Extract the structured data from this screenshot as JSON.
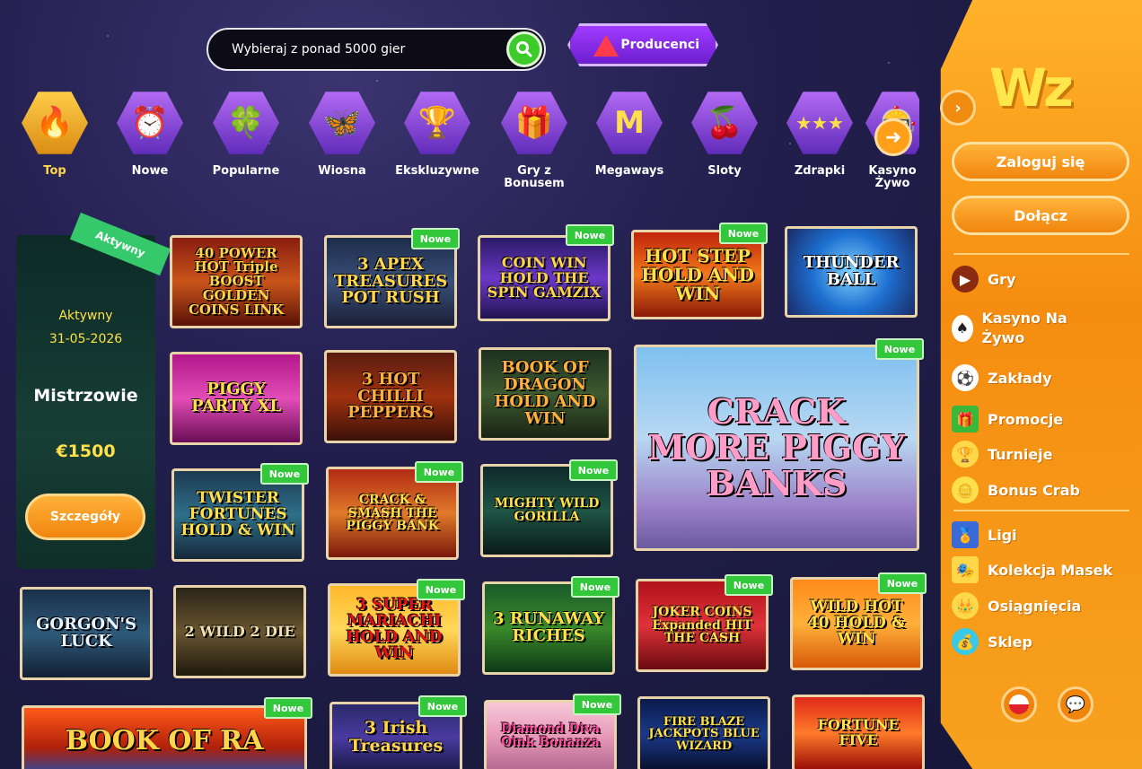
{
  "search": {
    "placeholder": "Wybieraj z ponad 5000 gier"
  },
  "producers_label": "Producenci",
  "categories": [
    {
      "label": "Top",
      "icon": "fire-icon"
    },
    {
      "label": "Nowe",
      "icon": "alarm-clock-icon"
    },
    {
      "label": "Popularne",
      "icon": "clover-icon"
    },
    {
      "label": "Wiosna",
      "icon": "butterfly-icon"
    },
    {
      "label": "Ekskluzywne",
      "icon": "trophy-icon"
    },
    {
      "label": "Gry z Bonusem",
      "icon": "gift-icon"
    },
    {
      "label": "Megaways",
      "icon": "megaways-icon"
    },
    {
      "label": "Sloty",
      "icon": "cherry-icon"
    },
    {
      "label": "Zdrapki",
      "icon": "scratch-card-icon"
    },
    {
      "label": "Kasyno Żywo",
      "icon": "live-casino-icon"
    }
  ],
  "promo": {
    "ribbon": "Aktywny",
    "status": "Aktywny",
    "date": "31-05-2026",
    "title": "Mistrzowie",
    "prize": "€1500",
    "button": "Szczegóły"
  },
  "badge_label": "Nowe",
  "games": [
    {
      "title": "40 POWER HOT Triple BOOST GOLDEN COINS LINK",
      "new": false
    },
    {
      "title": "3 APEX TREASURES POT RUSH",
      "new": true
    },
    {
      "title": "COIN WIN HOLD THE SPIN GAMZIX",
      "new": true
    },
    {
      "title": "HOT STEP HOLD AND WIN",
      "new": true
    },
    {
      "title": "THUNDER BALL",
      "new": false
    },
    {
      "title": "PIGGY PARTY XL",
      "new": false
    },
    {
      "title": "3 HOT CHILLI PEPPERS",
      "new": false
    },
    {
      "title": "BOOK OF DRAGON HOLD AND WIN",
      "new": false
    },
    {
      "title": "CRACK MORE PIGGY BANKS",
      "new": true
    },
    {
      "title": "TWISTER FORTUNES HOLD & WIN",
      "new": true
    },
    {
      "title": "CRACK & SMASH THE PIGGY BANK",
      "new": true
    },
    {
      "title": "MIGHTY WILD GORILLA",
      "new": true
    },
    {
      "title": "GORGON'S LUCK",
      "new": false
    },
    {
      "title": "2 WILD 2 DIE",
      "new": false
    },
    {
      "title": "3 SUPER MARIACHI HOLD AND WIN",
      "new": true
    },
    {
      "title": "3 RUNAWAY RICHES",
      "new": true
    },
    {
      "title": "JOKER COINS Expanded HIT THE CASH",
      "new": true
    },
    {
      "title": "WILD HOT 40 HOLD & WIN",
      "new": true
    },
    {
      "title": "BOOK OF RA",
      "new": true
    },
    {
      "title": "3 Irish Treasures",
      "new": true
    },
    {
      "title": "Diamond Diva Oink Bonanza",
      "new": true
    },
    {
      "title": "FIRE BLAZE JACKPOTS BLUE WIZARD",
      "new": false
    },
    {
      "title": "FORTUNE FIVE",
      "new": false
    }
  ],
  "sidebar": {
    "logo": "Wz",
    "login": "Zaloguj się",
    "join": "Dołącz",
    "menu": [
      {
        "label": "Gry",
        "icon": "play-icon"
      },
      {
        "label": "Kasyno Na Żywo",
        "icon": "cards-icon"
      },
      {
        "label": "Zakłady",
        "icon": "football-icon"
      },
      {
        "label": "Promocje",
        "icon": "gift-icon"
      },
      {
        "label": "Turnieje",
        "icon": "trophy-icon"
      },
      {
        "label": "Bonus Crab",
        "icon": "crab-coin-icon"
      },
      {
        "label": "Ligi",
        "icon": "league-icon"
      },
      {
        "label": "Kolekcja Masek",
        "icon": "mask-card-icon"
      },
      {
        "label": "Osiągnięcia",
        "icon": "crown-icon"
      },
      {
        "label": "Sklep",
        "icon": "shop-icon"
      }
    ]
  },
  "colors": {
    "accent_orange": "#f58d10",
    "new_badge": "#33c73c",
    "purple": "#7b2fd8"
  }
}
